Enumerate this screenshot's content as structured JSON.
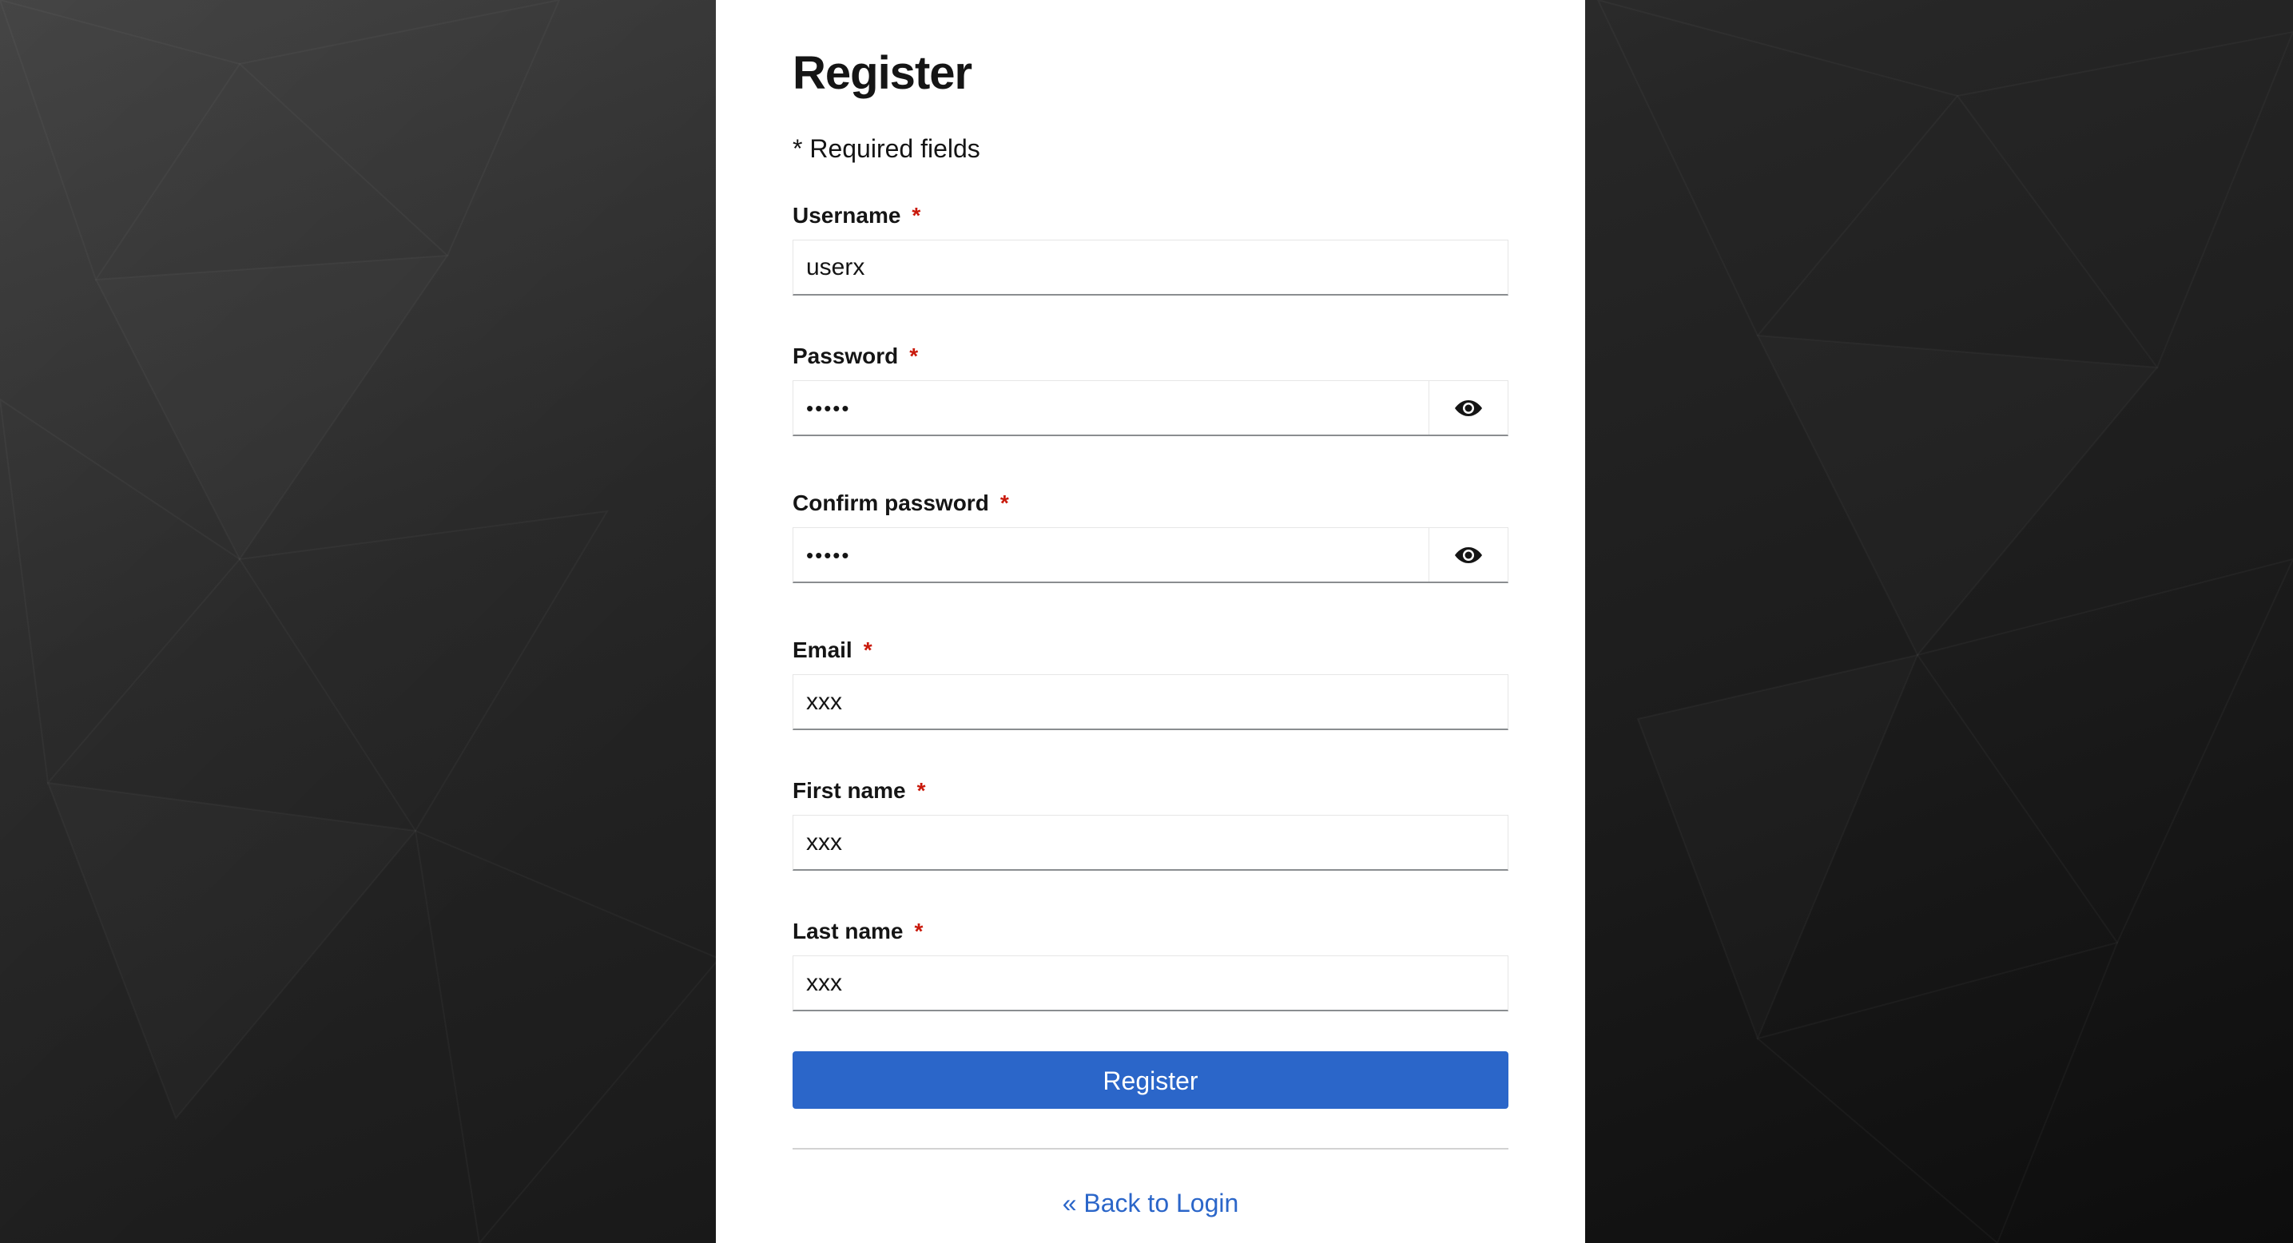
{
  "title": "Register",
  "required_note": "* Required fields",
  "required_marker": "*",
  "fields": {
    "username": {
      "label": "Username",
      "value": "userx"
    },
    "password": {
      "label": "Password",
      "value": "•••••",
      "toggle_icon": "eye-icon"
    },
    "confirm_password": {
      "label": "Confirm password",
      "value": "•••••",
      "toggle_icon": "eye-icon"
    },
    "email": {
      "label": "Email",
      "value": "xxx"
    },
    "first_name": {
      "label": "First name",
      "value": "xxx"
    },
    "last_name": {
      "label": "Last name",
      "value": "xxx"
    }
  },
  "register_button": "Register",
  "back_link": "« Back to Login",
  "colors": {
    "primary": "#2b66c9",
    "required_star": "#c9190b",
    "background_dark": "#1c1c1c"
  }
}
